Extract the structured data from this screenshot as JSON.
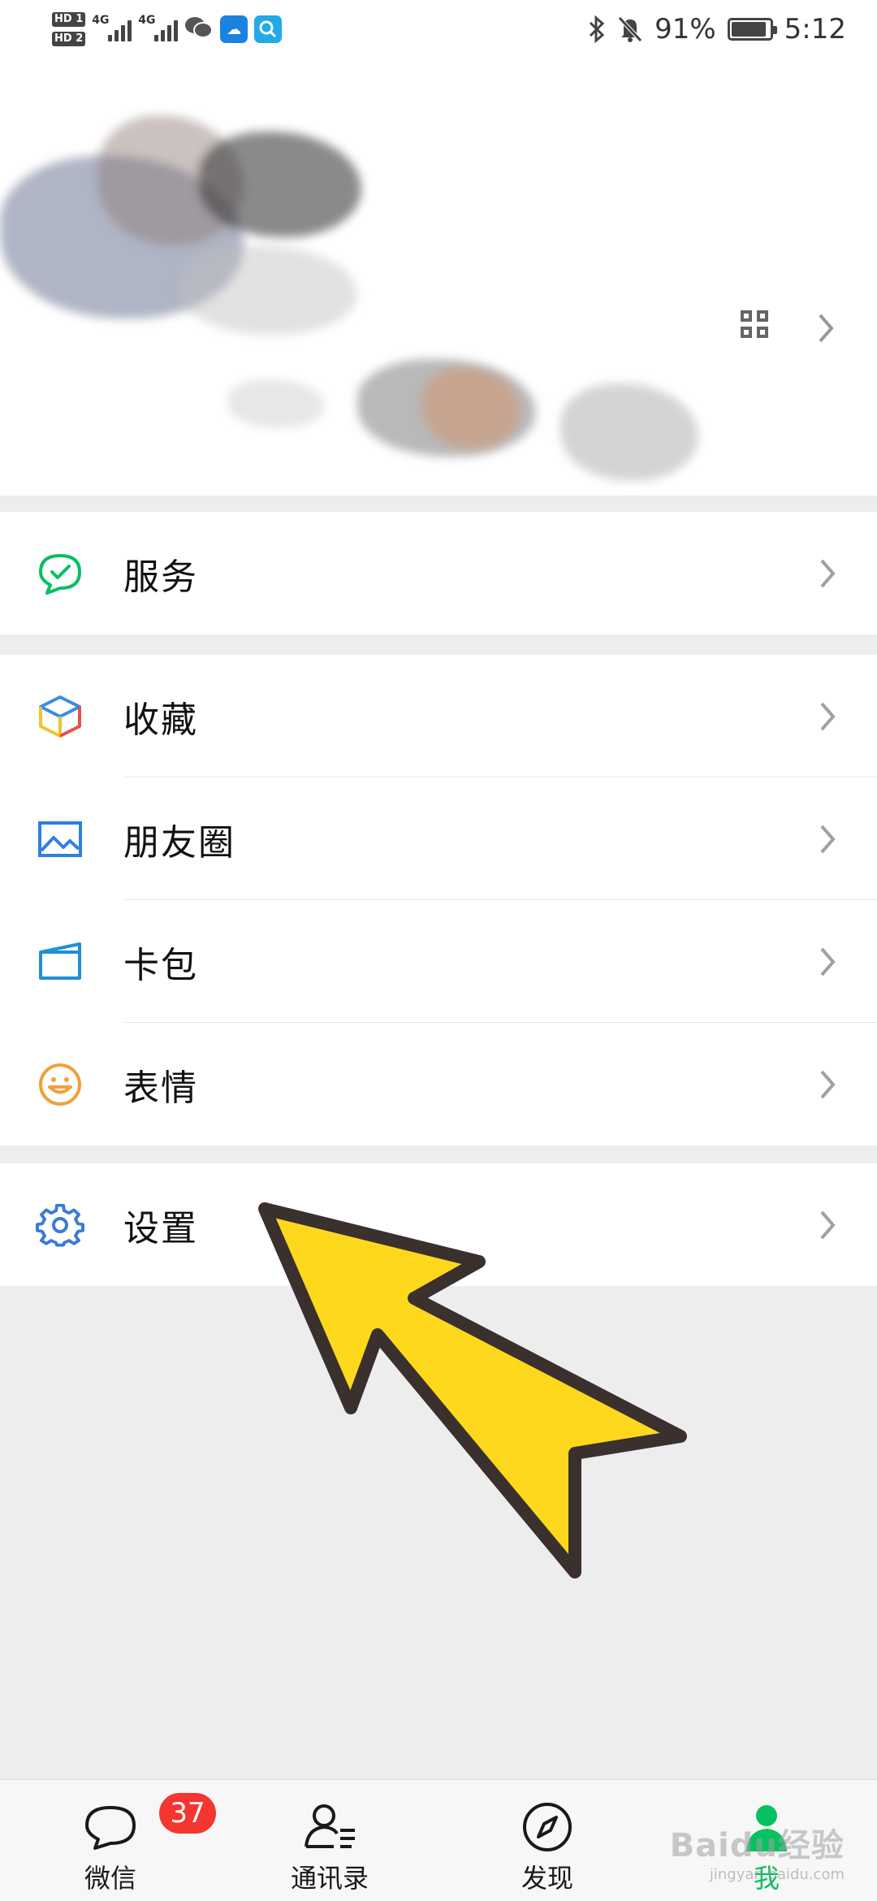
{
  "status_bar": {
    "sim1": "HD 1",
    "sim2": "HD 2",
    "network1": "4G",
    "network2": "4G",
    "battery_percent_label": "91%",
    "battery_level": 0.91,
    "time": "5:12",
    "icons": [
      "bluetooth-icon",
      "mute-bell-icon",
      "wechat-notify-icon",
      "weather-app-icon",
      "search-app-icon"
    ]
  },
  "profile": {
    "qr_icon": "qr-code-icon",
    "chevron_icon": "chevron-right-icon"
  },
  "menu": {
    "group1": [
      {
        "label": "服务",
        "icon": "service-check-icon",
        "color": "#07c160"
      }
    ],
    "group2": [
      {
        "label": "收藏",
        "icon": "favorites-cube-icon",
        "color": "#3b8be8"
      },
      {
        "label": "朋友圈",
        "icon": "moments-image-icon",
        "color": "#2f80e0"
      },
      {
        "label": "卡包",
        "icon": "card-wallet-icon",
        "color": "#1e90d6"
      },
      {
        "label": "表情",
        "icon": "sticker-smile-icon",
        "color": "#f0a03c"
      }
    ],
    "group3": [
      {
        "label": "设置",
        "icon": "settings-gear-icon",
        "color": "#3a7bd5"
      }
    ]
  },
  "tabbar": {
    "tabs": [
      {
        "label": "微信",
        "icon": "chat-bubble-icon",
        "badge": "37"
      },
      {
        "label": "通讯录",
        "icon": "contacts-icon"
      },
      {
        "label": "发现",
        "icon": "compass-icon"
      },
      {
        "label": "我",
        "icon": "me-person-icon",
        "active": true
      }
    ],
    "active_color": "#07c160"
  },
  "watermark": {
    "text": "Baidu经验",
    "sub": "jingyan.baidu.com"
  },
  "colors": {
    "arrow_fill": "#fed81c",
    "arrow_stroke": "#3a302e",
    "page_bg": "#ededed"
  }
}
